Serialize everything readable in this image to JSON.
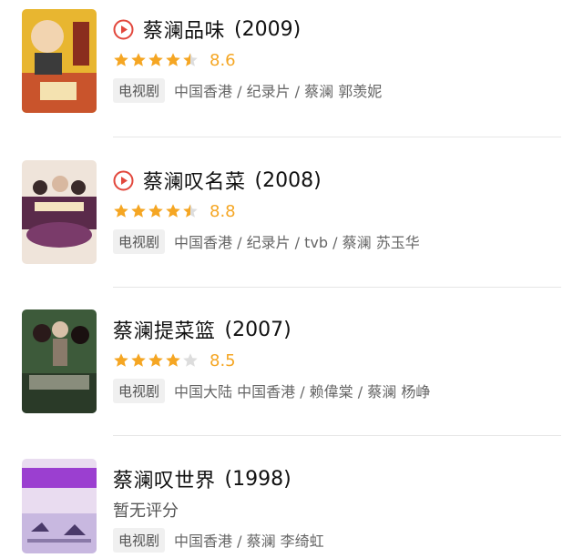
{
  "items": [
    {
      "title": "蔡澜品味",
      "year": "(2009)",
      "playable": true,
      "rating_stars": 4.5,
      "score": "8.6",
      "tag": "电视剧",
      "meta": "中国香港 / 纪录片 / 蔡澜 郭羡妮"
    },
    {
      "title": "蔡澜叹名菜",
      "year": "(2008)",
      "playable": true,
      "rating_stars": 4.5,
      "score": "8.8",
      "tag": "电视剧",
      "meta": "中国香港 / 纪录片 / tvb / 蔡澜 苏玉华"
    },
    {
      "title": "蔡澜提菜篮",
      "year": "(2007)",
      "playable": false,
      "rating_stars": 4,
      "score": "8.5",
      "tag": "电视剧",
      "meta": "中国大陆 中国香港 / 赖偉棠 / 蔡澜 杨峥"
    },
    {
      "title": "蔡澜叹世界",
      "year": "(1998)",
      "playable": false,
      "rating_stars": 0,
      "no_rating": "暂无评分",
      "tag": "电视剧",
      "meta": "中国香港 / 蔡澜 李绮虹"
    }
  ],
  "colors": {
    "star": "#f5a623",
    "star_empty": "#dddddd",
    "play": "#e2483d"
  }
}
